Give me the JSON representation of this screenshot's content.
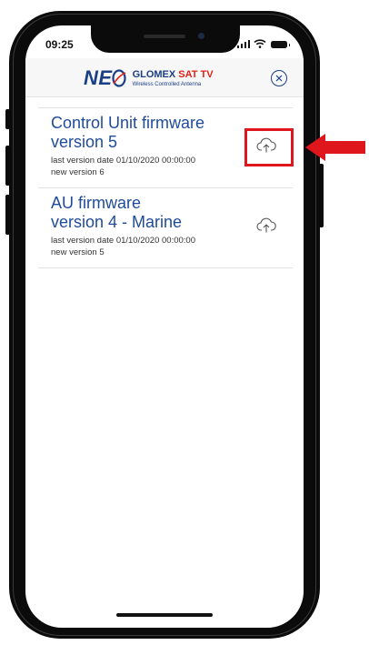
{
  "status_bar": {
    "time": "09:25"
  },
  "header": {
    "logo_mark": "NE",
    "brand_prefix": "GLOMEX ",
    "brand_suffix": "SAT TV",
    "tagline": "Wireless Controlled Antenna",
    "close_icon": "close-circle-icon"
  },
  "firmware": [
    {
      "title_line1": "Control Unit firmware",
      "title_line2": "version 5",
      "last_version_date": "last version date 01/10/2020 00:00:00",
      "new_version": "new version 6",
      "action_icon": "cloud-upload-icon",
      "highlighted": true
    },
    {
      "title_line1": "AU firmware",
      "title_line2": "version 4 - Marine",
      "last_version_date": "last version date 01/10/2020 00:00:00",
      "new_version": "new version 5",
      "action_icon": "cloud-upload-icon",
      "highlighted": false
    }
  ],
  "colors": {
    "brand_blue": "#1a3f86",
    "title_blue": "#1f4b9b",
    "highlight_red": "#e0161d"
  }
}
